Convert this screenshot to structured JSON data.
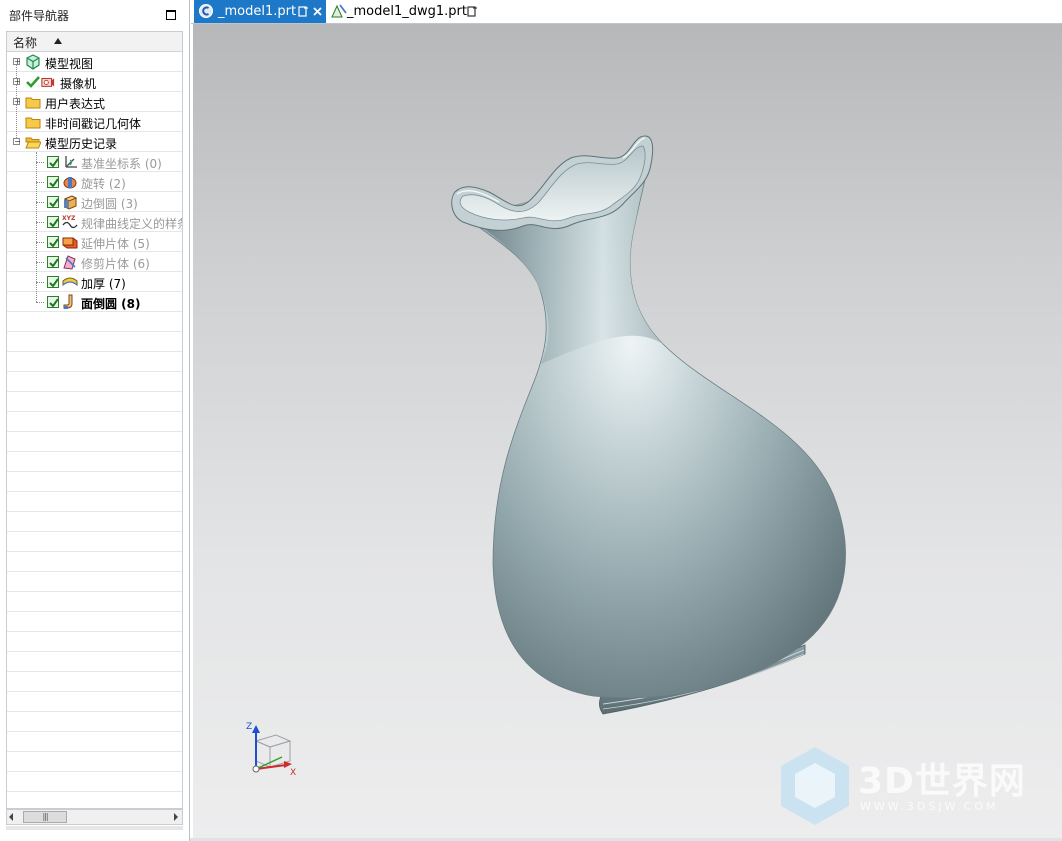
{
  "navigator": {
    "title": "部件导航器",
    "column_name": "名称",
    "nodes": [
      {
        "label": "模型视图",
        "icon": "model-views-icon",
        "expandable": true
      },
      {
        "label": "摄像机",
        "icon": "camera-icon",
        "expandable": true
      },
      {
        "label": "用户表达式",
        "icon": "folder-icon",
        "expandable": true
      },
      {
        "label": "非时间戳记几何体",
        "icon": "folder-icon",
        "expandable": false
      },
      {
        "label": "模型历史记录",
        "icon": "folder-open-icon",
        "expandable": true
      }
    ],
    "features": [
      {
        "label": "基准坐标系 (0)",
        "icon": "datum-csys-icon",
        "state": "dim"
      },
      {
        "label": "旋转 (2)",
        "icon": "revolve-icon",
        "state": "dim"
      },
      {
        "label": "边倒圆 (3)",
        "icon": "edge-blend-icon",
        "state": "dim"
      },
      {
        "label": "规律曲线定义的样条",
        "icon": "law-curve-icon",
        "state": "dim"
      },
      {
        "label": "延伸片体 (5)",
        "icon": "extend-sheet-icon",
        "state": "dim"
      },
      {
        "label": "修剪片体 (6)",
        "icon": "trim-sheet-icon",
        "state": "dim"
      },
      {
        "label": "加厚 (7)",
        "icon": "thicken-icon",
        "state": "normal"
      },
      {
        "label": "面倒圆 (8)",
        "icon": "face-blend-icon",
        "state": "bold"
      }
    ]
  },
  "tabs": [
    {
      "label": "_model1.prt",
      "active": true
    },
    {
      "label": "_model1_dwg1.prt",
      "active": false
    }
  ],
  "triad": {
    "z": "Z",
    "x": "X"
  },
  "watermark": {
    "text": "3D世界网",
    "sub": "WWW.3DSJW.COM"
  },
  "colors": {
    "tab_active": "#1e78c8",
    "check": "#2f7d2f",
    "vase": "#a9bcc0"
  }
}
